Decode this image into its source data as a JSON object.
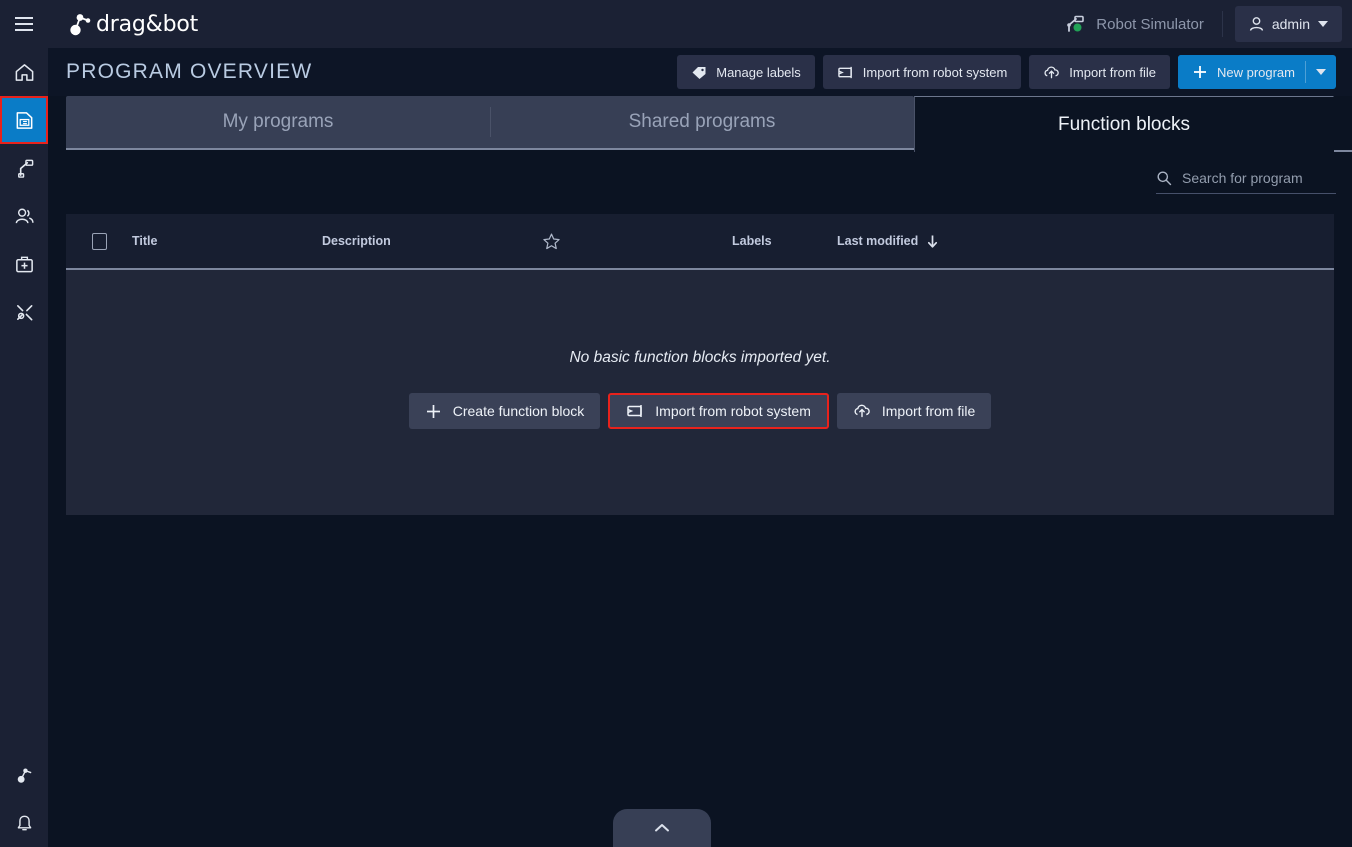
{
  "topbar": {
    "menu_icon": "hamburger-icon",
    "brand": "drag&bot",
    "robot_status": {
      "label": "Robot Simulator",
      "icon": "robot-arm-icon",
      "dot_color": "#21a256"
    },
    "user": {
      "name": "admin",
      "icon": "person-icon",
      "caret": "chevron-down-icon"
    }
  },
  "sidebar": {
    "items": [
      {
        "name": "home",
        "icon": "home-icon",
        "active": false
      },
      {
        "name": "programs",
        "icon": "program-list-icon",
        "active": true,
        "highlighted": true
      },
      {
        "name": "robot",
        "icon": "robot-arm-icon",
        "active": false
      },
      {
        "name": "users",
        "icon": "users-icon",
        "active": false
      },
      {
        "name": "toolbox",
        "icon": "first-aid-kit-icon",
        "active": false
      },
      {
        "name": "tools",
        "icon": "wrench-screwdriver-icon",
        "active": false
      }
    ],
    "bottom_items": [
      {
        "name": "robot-control",
        "icon": "robot-joint-icon"
      },
      {
        "name": "notifications",
        "icon": "bell-icon"
      }
    ]
  },
  "page": {
    "title": "PROGRAM OVERVIEW",
    "toolbar": {
      "manage_labels": {
        "label": "Manage labels",
        "icon": "tag-icon"
      },
      "import_robot": {
        "label": "Import from robot system",
        "icon": "robot-import-icon"
      },
      "import_file": {
        "label": "Import from file",
        "icon": "cloud-upload-icon"
      },
      "new_program": {
        "label": "New program",
        "icon": "plus-icon",
        "caret": "chevron-down-icon"
      }
    }
  },
  "tabs": [
    {
      "label": "My programs",
      "active": false
    },
    {
      "label": "Shared programs",
      "active": false
    },
    {
      "label": "Function blocks",
      "active": true
    }
  ],
  "search": {
    "placeholder": "Search for program",
    "value": "",
    "icon": "search-icon"
  },
  "table": {
    "columns": {
      "select_all": "",
      "title": "Title",
      "description": "Description",
      "favorite": "star-icon",
      "labels": "Labels",
      "last_modified": "Last modified",
      "sort_icon": "arrow-down-icon"
    },
    "rows": [],
    "empty_state": {
      "message": "No basic function blocks imported yet.",
      "actions": [
        {
          "label": "Create function block",
          "icon": "plus-icon",
          "highlighted": false
        },
        {
          "label": "Import from robot system",
          "icon": "robot-import-icon",
          "highlighted": true
        },
        {
          "label": "Import from file",
          "icon": "cloud-upload-icon",
          "highlighted": false
        }
      ]
    }
  },
  "bottom_panel": {
    "icon": "chevron-up-icon"
  },
  "colors": {
    "accent": "#0a7cc7",
    "highlight": "#e8221c",
    "topbar_bg": "#1b2134",
    "page_bg": "#0b1322",
    "panel_bg": "#212739",
    "tab_bg": "#373f55",
    "status_dot": "#21a256"
  }
}
